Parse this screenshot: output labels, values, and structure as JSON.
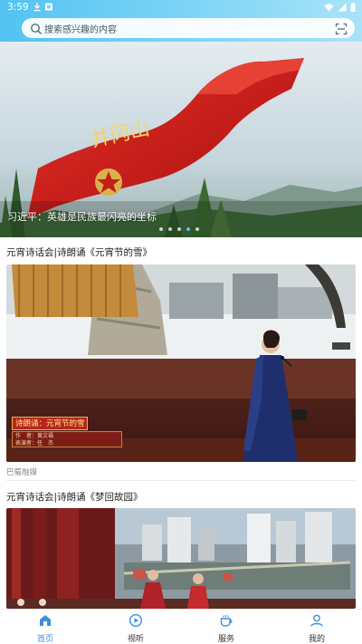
{
  "status_bar": {
    "time": "3:59"
  },
  "search": {
    "placeholder": "搜索感兴趣的内容",
    "search_icon": "search-icon",
    "scan_icon": "scan-icon"
  },
  "banner": {
    "caption": "习近平：英雄是民族最闪亮的坐标",
    "flag_text": "井冈山",
    "slide_count": 5,
    "active_slide": 4
  },
  "articles": [
    {
      "title": "元宵诗话会|诗朗诵《元宵节的雪》",
      "overlay_title": "诗朗诵：元宵节的雪",
      "overlay_author": "作　者：黄文福",
      "overlay_performer": "表演者：任　杰",
      "source": "巴蜀融媒"
    },
    {
      "title": "元宵诗话会|诗朗诵《梦回故园》"
    }
  ],
  "bottom_nav": {
    "items": [
      {
        "label": "首页",
        "icon": "home-icon",
        "active": true
      },
      {
        "label": "视听",
        "icon": "play-icon",
        "active": false
      },
      {
        "label": "服务",
        "icon": "cup-icon",
        "active": false
      },
      {
        "label": "我的",
        "icon": "user-icon",
        "active": false
      }
    ]
  },
  "colors": {
    "accent": "#3a8fe0",
    "header_start": "#53c3f2",
    "header_end": "#a9e3f8"
  }
}
